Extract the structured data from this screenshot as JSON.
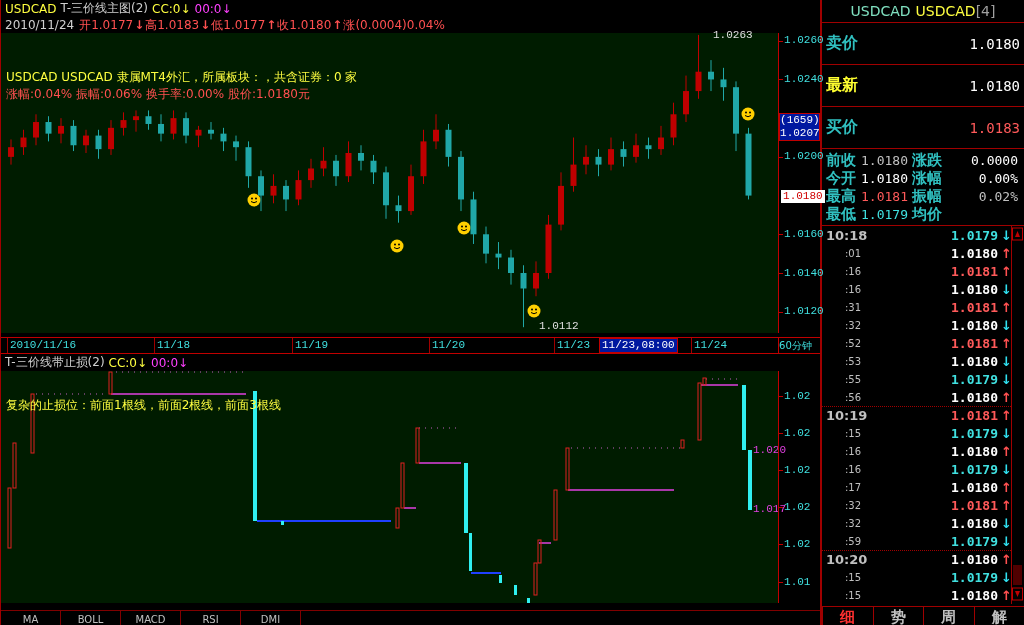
{
  "main_chart": {
    "title": {
      "symbol": "USDCAD",
      "indicator": "T-三价线主图(2)",
      "cc": "CC:0↓",
      "oo": "00:0↓"
    },
    "bar_info": {
      "date": "2010/11/24",
      "fields": [
        {
          "text": "开1.0177",
          "arrow": "↓"
        },
        {
          "text": "高1.0183",
          "arrow": "↓"
        },
        {
          "text": "低1.0177",
          "arrow": "↑"
        },
        {
          "text": "收1.0180",
          "arrow": "↑"
        },
        {
          "text": "涨(0.0004)0.04%"
        }
      ]
    },
    "info_lines": [
      "USDCAD USDCAD 隶属MT4外汇，所属板块：，共含证券：0 家",
      "涨幅:0.04% 振幅:0.06% 换手率:0.00% 股价:1.0180元"
    ],
    "high_label": "1.0263",
    "low_label": "1.0112",
    "cursor_tag": {
      "count": "(1659)",
      "price": "1.0207"
    },
    "price_tag": "1.0180",
    "chart_data": {
      "type": "candlestick",
      "ylim": [
        1.0109,
        1.0264
      ],
      "yticks": [
        {
          "value": 1.026,
          "label": "1.0260"
        },
        {
          "value": 1.024,
          "label": "1.0240"
        },
        {
          "value": 1.02,
          "label": "1.0200"
        },
        {
          "value": 1.016,
          "label": "1.0160"
        },
        {
          "value": 1.014,
          "label": "1.0140"
        },
        {
          "value": 1.012,
          "label": "1.0120"
        }
      ],
      "categories": [
        null,
        null,
        null,
        null,
        null,
        null,
        null,
        null,
        null,
        null,
        null,
        null,
        null,
        null,
        null,
        null,
        null,
        null,
        null,
        null,
        null,
        null,
        null,
        null,
        null,
        null,
        null,
        null,
        null,
        null,
        null,
        null,
        null,
        null,
        null,
        null,
        null,
        null,
        null,
        null,
        null,
        null,
        null,
        null,
        null,
        null,
        null,
        null,
        null,
        null,
        null,
        null,
        null,
        null,
        null,
        null,
        null,
        null,
        null,
        null
      ],
      "ohlc": [
        [
          1.02,
          1.0209,
          1.0196,
          1.0205
        ],
        [
          1.0205,
          1.0214,
          1.0201,
          1.021
        ],
        [
          1.021,
          1.0222,
          1.0206,
          1.0218
        ],
        [
          1.0218,
          1.0221,
          1.0208,
          1.0212
        ],
        [
          1.0212,
          1.022,
          1.0207,
          1.0216
        ],
        [
          1.0216,
          1.0219,
          1.0203,
          1.0206
        ],
        [
          1.0206,
          1.0214,
          1.0202,
          1.0211
        ],
        [
          1.0211,
          1.0214,
          1.0199,
          1.0204
        ],
        [
          1.0204,
          1.0219,
          1.0201,
          1.0215
        ],
        [
          1.0215,
          1.0223,
          1.0211,
          1.0219
        ],
        [
          1.0219,
          1.0224,
          1.0213,
          1.0221
        ],
        [
          1.0221,
          1.0224,
          1.0214,
          1.0217
        ],
        [
          1.0217,
          1.0222,
          1.0208,
          1.0212
        ],
        [
          1.0212,
          1.0224,
          1.0209,
          1.022
        ],
        [
          1.022,
          1.0223,
          1.0207,
          1.0211
        ],
        [
          1.0211,
          1.0216,
          1.0205,
          1.0214
        ],
        [
          1.0214,
          1.0218,
          1.0209,
          1.0212
        ],
        [
          1.0212,
          1.0215,
          1.0203,
          1.0208
        ],
        [
          1.0208,
          1.0211,
          1.0198,
          1.0205
        ],
        [
          1.0205,
          1.0208,
          1.0184,
          1.019
        ],
        [
          1.019,
          1.0193,
          1.0172,
          1.018
        ],
        [
          1.018,
          1.0191,
          1.0176,
          1.0185
        ],
        [
          1.0185,
          1.0188,
          1.0172,
          1.0178
        ],
        [
          1.0178,
          1.0193,
          1.0175,
          1.0188
        ],
        [
          1.0188,
          1.0199,
          1.0184,
          1.0194
        ],
        [
          1.0194,
          1.0205,
          1.019,
          1.0198
        ],
        [
          1.0198,
          1.0201,
          1.0185,
          1.019
        ],
        [
          1.019,
          1.0208,
          1.0187,
          1.0202
        ],
        [
          1.0202,
          1.0206,
          1.0193,
          1.0198
        ],
        [
          1.0198,
          1.0201,
          1.0186,
          1.0192
        ],
        [
          1.0192,
          1.0195,
          1.0168,
          1.0175
        ],
        [
          1.0175,
          1.018,
          1.0166,
          1.0172
        ],
        [
          1.0172,
          1.0196,
          1.017,
          1.019
        ],
        [
          1.019,
          1.0214,
          1.0186,
          1.0208
        ],
        [
          1.0208,
          1.0222,
          1.0204,
          1.0214
        ],
        [
          1.0214,
          1.0217,
          1.0195,
          1.02
        ],
        [
          1.02,
          1.0203,
          1.0172,
          1.0178
        ],
        [
          1.0178,
          1.0182,
          1.0155,
          1.016
        ],
        [
          1.016,
          1.0164,
          1.0145,
          1.015
        ],
        [
          1.015,
          1.0156,
          1.0142,
          1.0148
        ],
        [
          1.0148,
          1.0152,
          1.0134,
          1.014
        ],
        [
          1.014,
          1.0144,
          1.0112,
          1.0132
        ],
        [
          1.0132,
          1.0146,
          1.0128,
          1.014
        ],
        [
          1.014,
          1.017,
          1.0137,
          1.0165
        ],
        [
          1.0165,
          1.0192,
          1.0162,
          1.0185
        ],
        [
          1.0185,
          1.021,
          1.0182,
          1.0196
        ],
        [
          1.0196,
          1.0206,
          1.0191,
          1.02
        ],
        [
          1.02,
          1.0204,
          1.019,
          1.0196
        ],
        [
          1.0196,
          1.021,
          1.0193,
          1.0204
        ],
        [
          1.0204,
          1.0208,
          1.0195,
          1.02
        ],
        [
          1.02,
          1.0212,
          1.0197,
          1.0206
        ],
        [
          1.0206,
          1.021,
          1.0199,
          1.0204
        ],
        [
          1.0204,
          1.0216,
          1.0201,
          1.021
        ],
        [
          1.021,
          1.0228,
          1.0206,
          1.0222
        ],
        [
          1.0222,
          1.0242,
          1.0218,
          1.0234
        ],
        [
          1.0234,
          1.0263,
          1.023,
          1.0244
        ],
        [
          1.0244,
          1.025,
          1.0234,
          1.024
        ],
        [
          1.024,
          1.0246,
          1.0229,
          1.0236
        ],
        [
          1.0236,
          1.0239,
          1.0203,
          1.0212
        ],
        [
          1.0212,
          1.0215,
          1.0178,
          1.018
        ]
      ]
    }
  },
  "date_axis": {
    "labels": [
      {
        "text": "2010/11/16",
        "selected": false
      },
      {
        "text": "11/18",
        "selected": false
      },
      {
        "text": "11/19",
        "selected": false
      },
      {
        "text": "11/20",
        "selected": false
      },
      {
        "text": "11/23",
        "selected": false
      },
      {
        "text": "11/23,08:00",
        "selected": true
      },
      {
        "text": "11/24",
        "selected": false
      }
    ],
    "period": "60分钟"
  },
  "lower_chart": {
    "title": {
      "indicator": "T-三价线带止损(2)",
      "cc": "CC:0↓",
      "oo": "00:0↓"
    },
    "note": "复杂的止损位：前面1根线，前面2根线，前面3根线",
    "y_axis": [
      "1.02",
      "1.02",
      "1.02",
      "1.02",
      "1.02",
      "1.01"
    ],
    "line_labels": [
      "1.020",
      "1.017"
    ]
  },
  "indicator_tabs": [
    "MA",
    "BOLL",
    "MACD",
    "RSI",
    "DMI"
  ],
  "quote_panel": {
    "header": {
      "code": "USDCAD",
      "name": "USDCAD",
      "count": "[4]"
    },
    "quotes": [
      {
        "label": "卖价",
        "value": "1.0180",
        "kind": "normal",
        "color": "#ffffff"
      },
      {
        "label": "最新",
        "value": "1.0180",
        "kind": "latest",
        "color": "#ffffff"
      },
      {
        "label": "买价",
        "value": "1.0183",
        "kind": "normal",
        "color": "#ff5a5a"
      }
    ],
    "stats": [
      {
        "label": "前收",
        "value": "1.0180",
        "color": "#c0c0c0"
      },
      {
        "label": "涨跌",
        "value": "0.0000",
        "color": "#ffffff"
      },
      {
        "label": "今开",
        "value": "1.0180",
        "color": "#ffffff"
      },
      {
        "label": "涨幅",
        "value": "0.00%",
        "color": "#ffffff"
      },
      {
        "label": "最高",
        "value": "1.0181",
        "color": "#ff5a5a"
      },
      {
        "label": "振幅",
        "value": "0.02%",
        "color": "#c0c0c0"
      },
      {
        "label": "最低",
        "value": "1.0179",
        "color": "#40e0e0"
      },
      {
        "label": "均价"
      }
    ],
    "ticks": [
      {
        "time": "10:18",
        "kind": "minute",
        "price": "1.0179",
        "color": "#40e0e0",
        "arrow": {
          "text": "↓",
          "color": "#30e0f0"
        }
      },
      {
        "time": ":01",
        "kind": "second",
        "price": "1.0180",
        "color": "#ffffff",
        "arrow": {
          "text": "↑",
          "color": "#ff5050"
        }
      },
      {
        "time": ":16",
        "kind": "second",
        "price": "1.0181",
        "color": "#ff5a5a",
        "arrow": {
          "text": "↑",
          "color": "#ff5050"
        }
      },
      {
        "time": ":16",
        "kind": "second",
        "price": "1.0180",
        "color": "#ffffff",
        "arrow": {
          "text": "↓",
          "color": "#30e0f0"
        }
      },
      {
        "time": ":31",
        "kind": "second",
        "price": "1.0181",
        "color": "#ff5a5a",
        "arrow": {
          "text": "↑",
          "color": "#ff5050"
        }
      },
      {
        "time": ":32",
        "kind": "second",
        "price": "1.0180",
        "color": "#ffffff",
        "arrow": {
          "text": "↓",
          "color": "#30e0f0"
        }
      },
      {
        "time": ":52",
        "kind": "second",
        "price": "1.0181",
        "color": "#ff5a5a",
        "arrow": {
          "text": "↑",
          "color": "#ff5050"
        }
      },
      {
        "time": ":53",
        "kind": "second",
        "price": "1.0180",
        "color": "#ffffff",
        "arrow": {
          "text": "↓",
          "color": "#30e0f0"
        }
      },
      {
        "time": ":55",
        "kind": "second",
        "price": "1.0179",
        "color": "#40e0e0",
        "arrow": {
          "text": "↓",
          "color": "#30e0f0"
        }
      },
      {
        "time": ":56",
        "kind": "second",
        "price": "1.0180",
        "color": "#ffffff",
        "arrow": {
          "text": "↑",
          "color": "#ff5050"
        }
      },
      {
        "time": "10:19",
        "kind": "minute",
        "price": "1.0181",
        "color": "#ff5a5a",
        "arrow": {
          "text": "↑",
          "color": "#ff5050"
        }
      },
      {
        "time": ":15",
        "kind": "second",
        "price": "1.0179",
        "color": "#40e0e0",
        "arrow": {
          "text": "↓",
          "color": "#30e0f0"
        }
      },
      {
        "time": ":16",
        "kind": "second",
        "price": "1.0180",
        "color": "#ffffff",
        "arrow": {
          "text": "↑",
          "color": "#ff5050"
        }
      },
      {
        "time": ":16",
        "kind": "second",
        "price": "1.0179",
        "color": "#40e0e0",
        "arrow": {
          "text": "↓",
          "color": "#30e0f0"
        }
      },
      {
        "time": ":17",
        "kind": "second",
        "price": "1.0180",
        "color": "#ffffff",
        "arrow": {
          "text": "↑",
          "color": "#ff5050"
        }
      },
      {
        "time": ":32",
        "kind": "second",
        "price": "1.0181",
        "color": "#ff5a5a",
        "arrow": {
          "text": "↑",
          "color": "#ff5050"
        }
      },
      {
        "time": ":32",
        "kind": "second",
        "price": "1.0180",
        "color": "#ffffff",
        "arrow": {
          "text": "↓",
          "color": "#30e0f0"
        }
      },
      {
        "time": ":59",
        "kind": "second",
        "price": "1.0179",
        "color": "#40e0e0",
        "arrow": {
          "text": "↓",
          "color": "#30e0f0"
        }
      },
      {
        "time": "10:20",
        "kind": "minute",
        "price": "1.0180",
        "color": "#ffffff",
        "arrow": {
          "text": "↑",
          "color": "#ff5050"
        }
      },
      {
        "time": ":15",
        "kind": "second",
        "price": "1.0179",
        "color": "#40e0e0",
        "arrow": {
          "text": "↓",
          "color": "#30e0f0"
        }
      },
      {
        "time": ":15",
        "kind": "second",
        "price": "1.0180",
        "color": "#ffffff",
        "arrow": {
          "text": "↑",
          "color": "#ff5050"
        }
      }
    ],
    "tabs": [
      {
        "label": "细",
        "selected": true
      },
      {
        "label": "势",
        "selected": false
      },
      {
        "label": "周",
        "selected": false
      },
      {
        "label": "解",
        "selected": false
      }
    ]
  }
}
